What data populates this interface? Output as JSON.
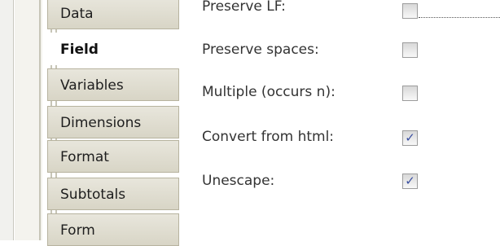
{
  "tabs": [
    {
      "label": "Data",
      "active": false
    },
    {
      "label": "Field",
      "active": true
    },
    {
      "label": "Variables",
      "active": false
    },
    {
      "label": "Dimensions",
      "active": false
    },
    {
      "label": "Format",
      "active": false
    },
    {
      "label": "Subtotals",
      "active": false
    },
    {
      "label": "Form",
      "active": false
    }
  ],
  "options": [
    {
      "label": "Preserve LF:",
      "checked": false
    },
    {
      "label": "Preserve spaces:",
      "checked": false
    },
    {
      "label": "Multiple (occurs n):",
      "checked": false
    },
    {
      "label": "Convert from html:",
      "checked": true
    },
    {
      "label": "Unescape:",
      "checked": true
    }
  ],
  "check_mark": "✓"
}
